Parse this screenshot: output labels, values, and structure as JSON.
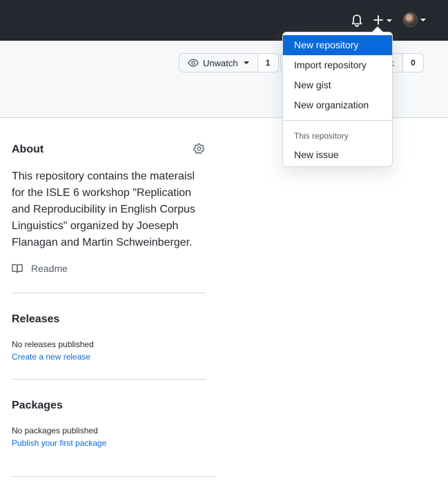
{
  "header": {
    "watch": {
      "label": "Unwatch",
      "count": "1"
    },
    "fork": {
      "label_fragment": "k",
      "count": "0"
    }
  },
  "dropdown_menu": {
    "items": [
      {
        "label": "New repository"
      },
      {
        "label": "Import repository"
      },
      {
        "label": "New gist"
      },
      {
        "label": "New organization"
      }
    ],
    "section_header": "This repository",
    "section_items": [
      {
        "label": "New issue"
      }
    ]
  },
  "about": {
    "title": "About",
    "description": "This repository contains the materaisl for the ISLE 6 workshop \"Replication and Reproducibility in English Corpus Linguistics\" organized by Joeseph Flanagan and Martin Schweinberger.",
    "readme_label": "Readme"
  },
  "releases": {
    "title": "Releases",
    "empty_text": "No releases published",
    "create_link": "Create a new release"
  },
  "packages": {
    "title": "Packages",
    "empty_text": "No packages published",
    "publish_link": "Publish your first package"
  },
  "icons": {
    "bell": "bell-icon",
    "plus": "plus-icon",
    "eye": "eye-icon",
    "gear": "gear-icon",
    "book": "book-icon"
  },
  "colors": {
    "topbar": "#24292f",
    "accent": "#0969da",
    "header_bg": "#f6f8fa",
    "border": "#d0d7de",
    "muted": "#57606a"
  }
}
